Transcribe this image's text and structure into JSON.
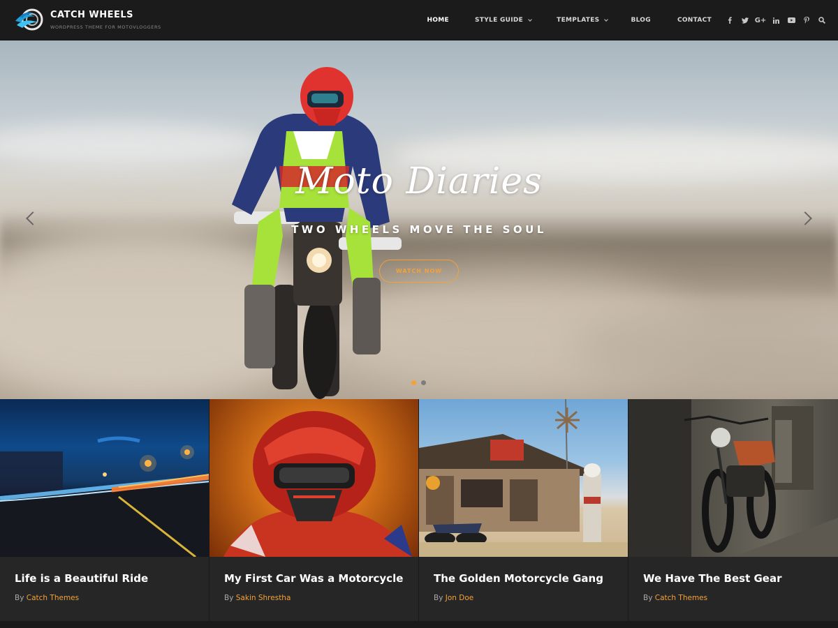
{
  "header": {
    "site_title": "CATCH WHEELS",
    "tagline": "WORDPRESS THEME FOR MOTOVLOGGERS",
    "logo_icon": "wheel-wave-logo"
  },
  "nav": {
    "items": [
      {
        "label": "HOME",
        "active": true,
        "has_dropdown": false
      },
      {
        "label": "STYLE GUIDE",
        "active": false,
        "has_dropdown": true
      },
      {
        "label": "TEMPLATES",
        "active": false,
        "has_dropdown": true
      },
      {
        "label": "BLOG",
        "active": false,
        "has_dropdown": false
      },
      {
        "label": "CONTACT",
        "active": false,
        "has_dropdown": false
      }
    ],
    "social": [
      {
        "icon": "facebook-icon",
        "glyph": "f"
      },
      {
        "icon": "twitter-icon",
        "glyph": "t"
      },
      {
        "icon": "google-plus-icon",
        "glyph": "G+"
      },
      {
        "icon": "linkedin-icon",
        "glyph": "in"
      },
      {
        "icon": "youtube-icon",
        "glyph": "yt"
      },
      {
        "icon": "pinterest-icon",
        "glyph": "P"
      }
    ],
    "search_icon": "search-icon"
  },
  "hero": {
    "title": "Moto Diaries",
    "subtitle": "TWO WHEELS MOVE THE SOUL",
    "button_label": "WATCH NOW",
    "slide_count": 2,
    "active_slide": 1
  },
  "posts": [
    {
      "title": "Life is a Beautiful Ride",
      "by": "By",
      "author": "Catch Themes"
    },
    {
      "title": "My First Car Was a Motorcycle",
      "by": "By",
      "author": "Sakin Shrestha"
    },
    {
      "title": "The Golden Motorcycle Gang",
      "by": "By",
      "author": "Jon Doe"
    },
    {
      "title": "We Have The Best Gear",
      "by": "By",
      "author": "Catch Themes"
    }
  ],
  "colors": {
    "accent": "#f3a23a",
    "header_bg": "#1b1b1b",
    "card_bg": "#262626"
  }
}
